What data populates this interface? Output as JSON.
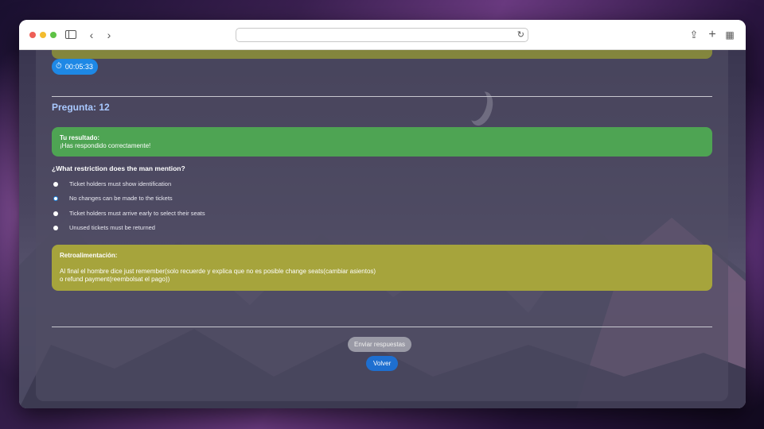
{
  "browser": {
    "address_value": "",
    "icons": [
      "sidebar-icon",
      "back-icon",
      "forward-icon",
      "reload-icon",
      "share-icon",
      "new-tab-icon",
      "tab-overview-icon"
    ]
  },
  "quiz": {
    "timer": "00:05:33",
    "question_label": "Pregunta: 12",
    "result": {
      "title": "Tu resultado:",
      "message": "¡Has respondido correctamente!"
    },
    "question": "¿What restriction does the man mention?",
    "options": [
      {
        "label": "Ticket holders must show identification",
        "selected": false
      },
      {
        "label": "No changes can be made to the tickets",
        "selected": true
      },
      {
        "label": "Ticket holders must arrive early to select their seats",
        "selected": false
      },
      {
        "label": "Unused tickets must be returned",
        "selected": false
      }
    ],
    "feedback": {
      "title": "Retroalimentación:",
      "line1": "Al final el hombre dice just remember(solo recuerde y explica que no es posible change seats(cambiar asientos)",
      "line2": "o refund payment(reembolsat el pago))"
    },
    "submit_label": "Enviar respuestas",
    "back_label": "Volver"
  },
  "colors": {
    "success": "#4ea453",
    "feedback": "#a6a43c",
    "accent": "#1e88e5",
    "question_number": "#a9c9ff"
  }
}
